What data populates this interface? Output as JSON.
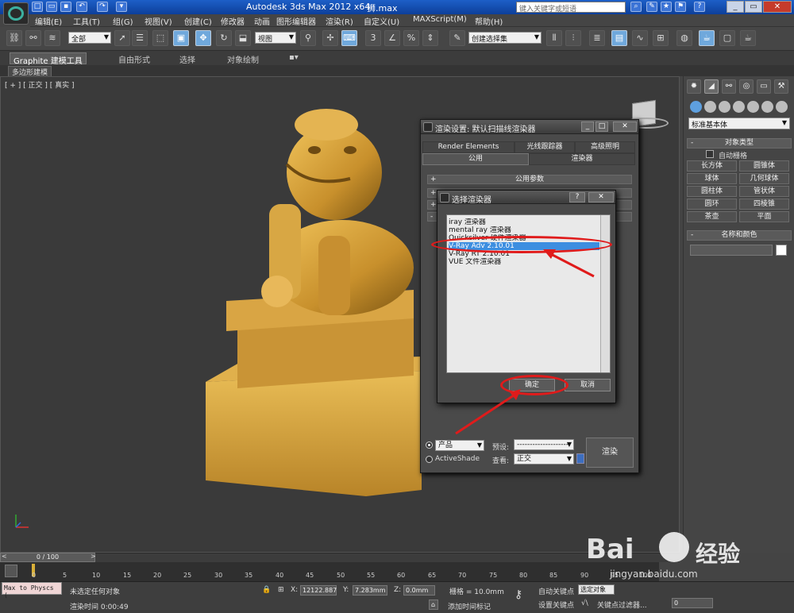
{
  "titlebar": {
    "app_title": "Autodesk 3ds Max  2012 x64",
    "file_name": "狮.max",
    "search_placeholder": "键入关键字或短语"
  },
  "menu": {
    "items": [
      "编辑(E)",
      "工具(T)",
      "组(G)",
      "视图(V)",
      "创建(C)",
      "修改器",
      "动画",
      "图形编辑器",
      "渲染(R)",
      "自定义(U)",
      "MAXScript(M)",
      "帮助(H)"
    ]
  },
  "toolbar": {
    "selection_filter": "全部",
    "ref_coord": "视图",
    "named_selection": "创建选择集"
  },
  "ribbon": {
    "tabs": [
      "Graphite 建模工具",
      "自由形式",
      "选择",
      "对象绘制"
    ],
    "sub_tab": "多边形建模"
  },
  "viewport": {
    "label": "[ + ] [ 正交 ] [ 真实 ]"
  },
  "command_panel": {
    "category": "标准基本体",
    "object_type_header": "对象类型",
    "autogrid_label": "自动栅格",
    "buttons": [
      "长方体",
      "圆锥体",
      "球体",
      "几何球体",
      "圆柱体",
      "管状体",
      "圆环",
      "四棱锥",
      "茶壶",
      "平面"
    ],
    "name_color_header": "名称和颜色"
  },
  "render_setup": {
    "title": "渲染设置: 默认扫描线渲染器",
    "tabs_row1": [
      "Render Elements",
      "光线跟踪器",
      "高级照明"
    ],
    "tabs_row2": [
      "公用",
      "渲染器"
    ],
    "rollout_common": "公用参数",
    "mode_dropdown": "产品",
    "preset_label": "预设:",
    "preset_value": "--------------------",
    "activeshade_label": "ActiveShade",
    "view_label": "查看:",
    "view_value": "正交",
    "render_button": "渲染"
  },
  "choose_renderer": {
    "title": "选择渲染器",
    "items": [
      "iray 渲染器",
      "mental ray 渲染器",
      "Quicksilver 硬件渲染器",
      "V-Ray Adv 2.10.01",
      "V-Ray RT 2.10.01",
      "VUE 文件渲染器"
    ],
    "selected_index": 3,
    "ok_label": "确定",
    "cancel_label": "取消"
  },
  "timeline": {
    "slider_label": "0 / 100",
    "ticks": [
      "0",
      "5",
      "10",
      "15",
      "20",
      "25",
      "30",
      "35",
      "40",
      "45",
      "50",
      "55",
      "60",
      "65",
      "70",
      "75",
      "80",
      "85",
      "90",
      "95",
      "100"
    ]
  },
  "status": {
    "maxscript": "Max to Physcs (",
    "selection_status": "未选定任何对象",
    "render_time": "渲染时间 0:00:49",
    "x_label": "X:",
    "x_value": "12122.887",
    "y_label": "Y:",
    "y_value": "7.283mm",
    "z_label": "Z:",
    "z_value": "0.0mm",
    "grid": "栅格 = 10.0mm",
    "add_time_tag": "添加时间标记",
    "auto_key": "自动关键点",
    "selected_obj": "选定对象",
    "set_key": "设置关键点",
    "key_filters": "关键点过滤器...",
    "frame": "0"
  },
  "watermark": {
    "brand": "Bai",
    "brand2": "经验",
    "url": "jingyan.baidu.com"
  },
  "colors": {
    "accent_red": "#e01b1b",
    "selection_blue": "#3d8ee0",
    "title_blue": "#1d5fc7",
    "model_gold": "#d9a23a"
  }
}
